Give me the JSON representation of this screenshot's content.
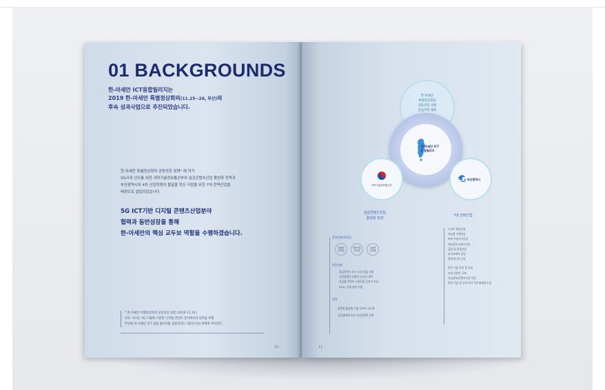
{
  "left_page": {
    "title": "01 BACKGROUNDS",
    "intro": {
      "line1": "한-아세안 ICT융합빌리지는",
      "line2a": "2019 한-아세안 특별정상회의",
      "line2b": "(11.25~26, 부산)",
      "line2c": "의",
      "line3": "후속 성과사업으로 추진되었습니다."
    },
    "body": [
      "한-아세안 특별정상회의 공동의장 성명* 에 의거",
      "5G시대 선도를 위한 과학기술정보통신부와 실감콘텐츠산업 활성화 전략과",
      "부산광역시의 4차 산업혁명의 물살을 혁신 거점을 위한 7대 전략산업을",
      "배경으로 설립되었습니다."
    ],
    "emphasis": [
      "5G ICT기반 디지털 콘텐츠산업분야",
      "협력과 동반성장을 통해",
      "한-아세안의 핵심 교두보 역할을 수행하겠습니다."
    ],
    "footnote": [
      "* 한-아세안 특별정상회의 공동의장 성명 (2019.11.26.)",
      "   모토: 우리는 5G 기술에 기반한 디지털 콘텐츠 분야에서의 협력을 위해",
      "   부산에 한-아세안 ICT 융합 빌리지를 설립하려는 대한민국의 계획에 주목한다."
    ],
    "page_number": "10"
  },
  "right_page": {
    "top_circle": [
      "한-아세안",
      "특별정상회의",
      "공동의장 성명",
      "관심지역 채택"
    ],
    "center_circle": [
      "한-아세안 ICT",
      "융합빌리지"
    ],
    "left_circle": "과학기술정보통신부",
    "right_circle": "부산광역시",
    "left_heading": [
      "실감콘텐츠산업",
      "활성화 전략"
    ],
    "right_heading": "7대 전략산업",
    "left_sub1": "전략목표(2022)",
    "left_dots": [
      [
        "매출액",
        "20조원"
      ],
      [
        "전문기업",
        "150개"
      ],
      [
        "수출액",
        "15조원"
      ]
    ],
    "left_sub2": "추진방향",
    "left_list1": [
      "실감콘텐츠 초기 시장 창출 지원",
      "사업경쟁력 강화로 신시장 개척",
      "실감형 콘텐츠 시장진출 인프라 조성",
      "R&D, 인재 양성 지원"
    ],
    "left_sub3": "전략",
    "left_list2": [
      "플랫폼 활성화    기술 인프라 고도화",
      "산업생태계 조성    산업경쟁력 강화"
    ],
    "right_list": [
      "스마트 해양산업",
      "지능형 기계산업",
      "미래 수송기기산업",
      "지능정보 서비스산업",
      "금융 및 관광산업",
      "라이프케어 산업",
      "클린에너지 산업",
      "관련 기업 유치 및 육성",
      "지역 콘텐츠 구축",
      "지능정보/콘텐츠산업 육성",
      "관련 기업 및 인력 유치 혁신생태계 조성"
    ],
    "page_number": "11"
  }
}
